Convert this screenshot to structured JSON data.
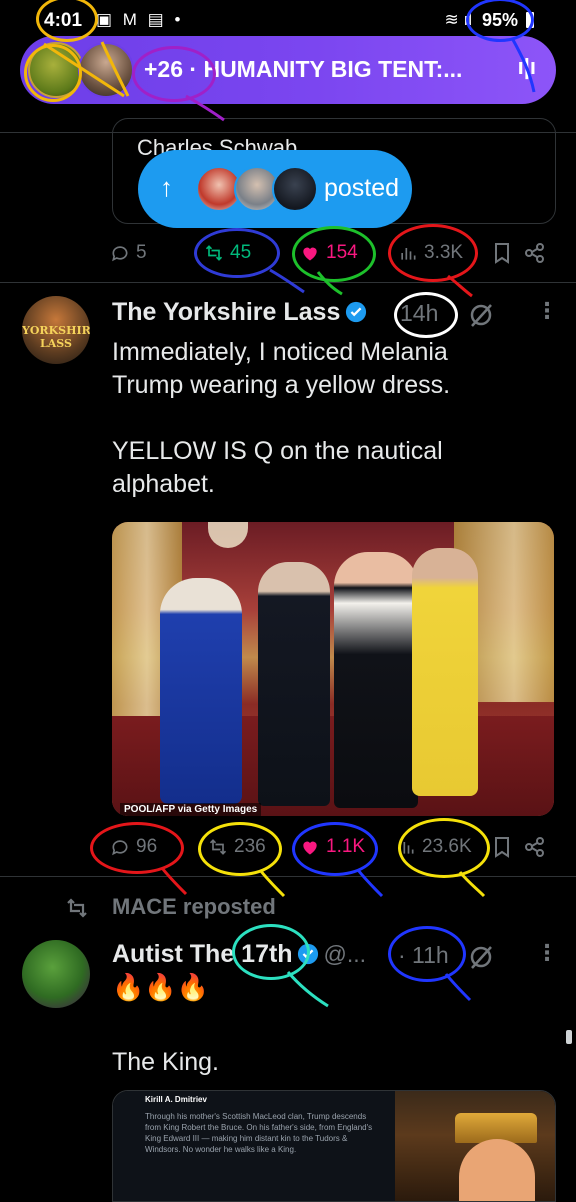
{
  "status_bar": {
    "time": "4:01",
    "left_icons": "▣ M ▤ •",
    "battery": "95%"
  },
  "spaces": {
    "title": "+26 · HUMANITY BIG TENT:...",
    "color": "#7b46f0"
  },
  "quoted_card": {
    "text": "Charles Schwab"
  },
  "posted_pill": {
    "label": "posted",
    "color": "#1d9bf0"
  },
  "prev_tweet_actions": {
    "replies": "5",
    "reposts": "45",
    "likes": "154",
    "views": "3.3K"
  },
  "tweet1": {
    "name": "The Yorkshire Lass",
    "avatar_text": "YORKSHIRE LASS",
    "time": "14h",
    "text_line1": "Immediately, I noticed Melania",
    "text_line2": "Trump wearing a yellow dress.",
    "text_line3": "YELLOW IS Q on the nautical",
    "text_line4": "alphabet.",
    "photo_credit": "POOL/AFP via Getty Images",
    "actions": {
      "replies": "96",
      "reposts": "236",
      "likes": "1.1K",
      "views": "23.6K"
    }
  },
  "repost": {
    "label": "MACE reposted"
  },
  "tweet2": {
    "name_a": "Autist The ",
    "name_b": "17th",
    "handle": "@...",
    "time": "· 11h",
    "emoji": "🔥🔥🔥",
    "text": "The King."
  },
  "embedded_card": {
    "author": "Kirill A. Dmitriev",
    "text": "Through his mother's Scottish MacLeod clan, Trump descends from King Robert the Bruce. On his father's side, from England's King Edward III — making him distant kin to the Tudors & Windsors. No wonder he walks like a King."
  },
  "colors": {
    "like": "#f91880",
    "repost": "#00ba7c",
    "muted": "#71767b",
    "verified": "#1d9bf0"
  }
}
